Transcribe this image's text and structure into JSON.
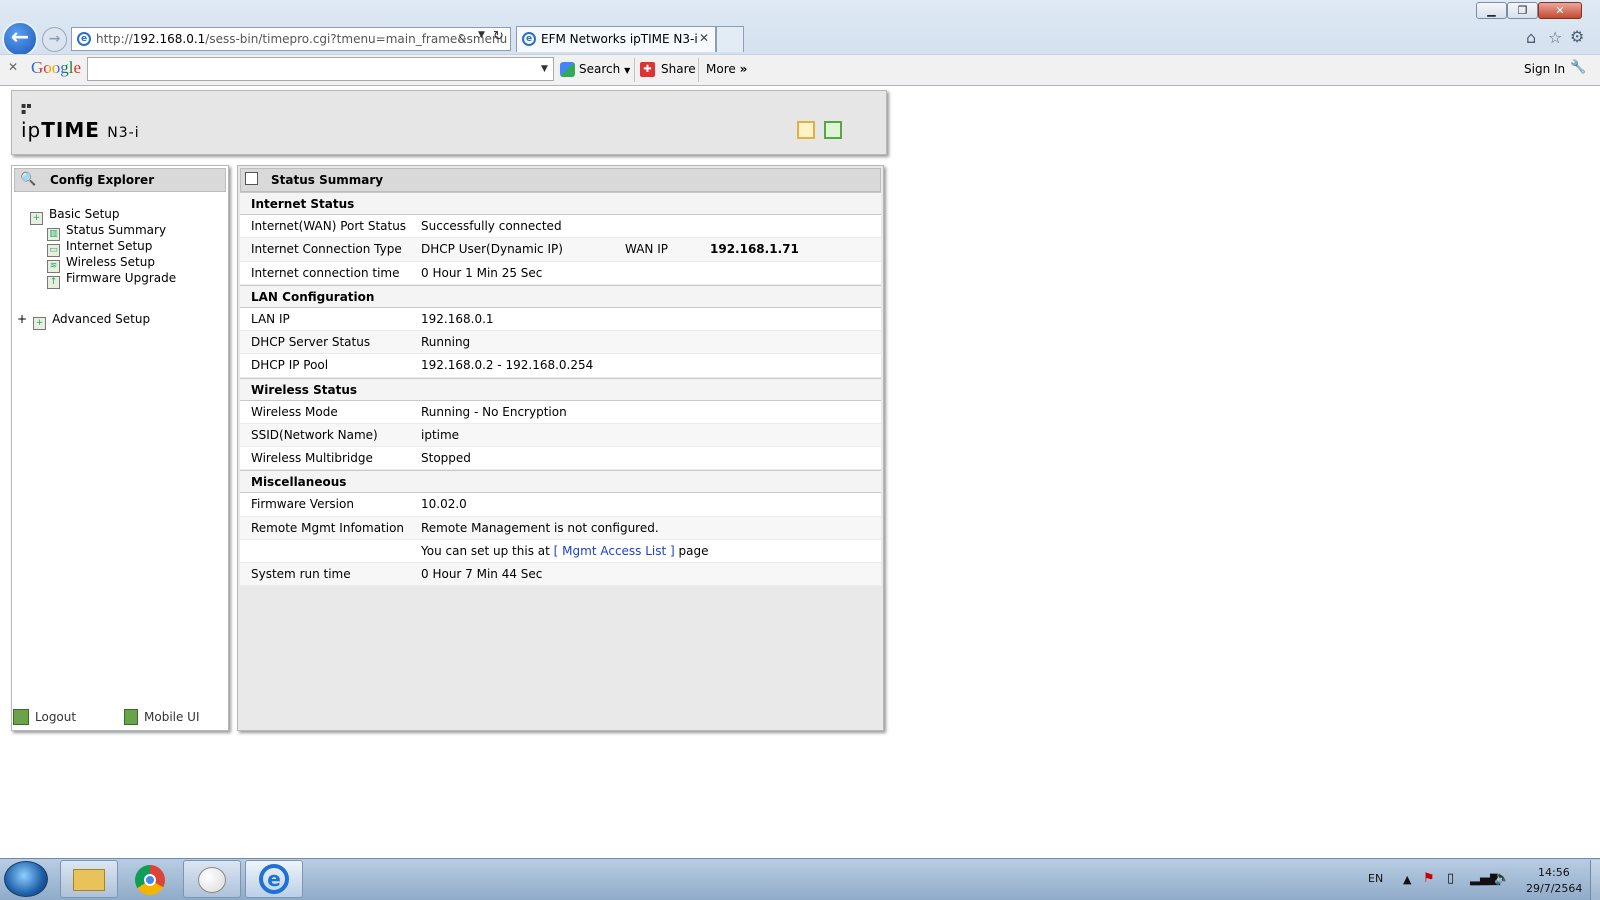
{
  "browser": {
    "url_prefix": "http://",
    "url_host": "192.168.0.1",
    "url_path": "/sess-bin/timepro.cgi?tmenu=main_frame&smenu",
    "tab_title": "EFM Networks ipTIME N3-i",
    "window": {
      "minimize": "▁",
      "restore": "❐",
      "close": "✕"
    }
  },
  "google_toolbar": {
    "logo": "Google",
    "search_label": "Search",
    "share_label": "Share",
    "more_label": "More",
    "sign_in_label": "Sign In"
  },
  "header": {
    "logo_prefix": "ip",
    "logo_brand": "TIME",
    "model": "N3-i"
  },
  "sidebar": {
    "title": "Config Explorer",
    "basic_setup": "Basic Setup",
    "items": [
      {
        "label": "Status Summary"
      },
      {
        "label": "Internet Setup"
      },
      {
        "label": "Wireless Setup"
      },
      {
        "label": "Firmware Upgrade"
      }
    ],
    "advanced_setup": "Advanced Setup",
    "logout_label": "Logout",
    "mobile_label": "Mobile UI"
  },
  "main": {
    "title": "Status Summary",
    "internet": {
      "section": "Internet Status",
      "wan_port_label": "Internet(WAN) Port Status",
      "wan_port_value": "Successfully connected",
      "conn_type_label": "Internet Connection Type",
      "conn_type_value": "DHCP User(Dynamic IP)",
      "wan_ip_label": "WAN IP",
      "wan_ip_value": "192.168.1.71",
      "conn_time_label": "Internet connection time",
      "conn_time_value": "0 Hour 1 Min 25 Sec"
    },
    "lan": {
      "section": "LAN Configuration",
      "lan_ip_label": "LAN IP",
      "lan_ip_value": "192.168.0.1",
      "dhcp_status_label": "DHCP Server Status",
      "dhcp_status_value": "Running",
      "dhcp_pool_label": "DHCP IP Pool",
      "dhcp_pool_value": "192.168.0.2 -  192.168.0.254"
    },
    "wireless": {
      "section": "Wireless Status",
      "mode_label": "Wireless Mode",
      "mode_value": "Running - No Encryption",
      "ssid_label": "SSID(Network Name)",
      "ssid_value": "iptime",
      "multibridge_label": "Wireless Multibridge",
      "multibridge_value": "Stopped"
    },
    "misc": {
      "section": "Miscellaneous",
      "firmware_label": "Firmware Version",
      "firmware_value": "10.02.0",
      "remote_label": "Remote Mgmt Infomation",
      "remote_value": "Remote Management is not configured.",
      "remote_hint_pre": "You can set up this at",
      "remote_hint_link": "[ Mgmt Access List ]",
      "remote_hint_post": "page",
      "runtime_label": "System run time",
      "runtime_value": "0 Hour 7 Min 44 Sec"
    }
  },
  "taskbar": {
    "lang": "EN",
    "time": "14:56",
    "date": "29/7/2564"
  }
}
